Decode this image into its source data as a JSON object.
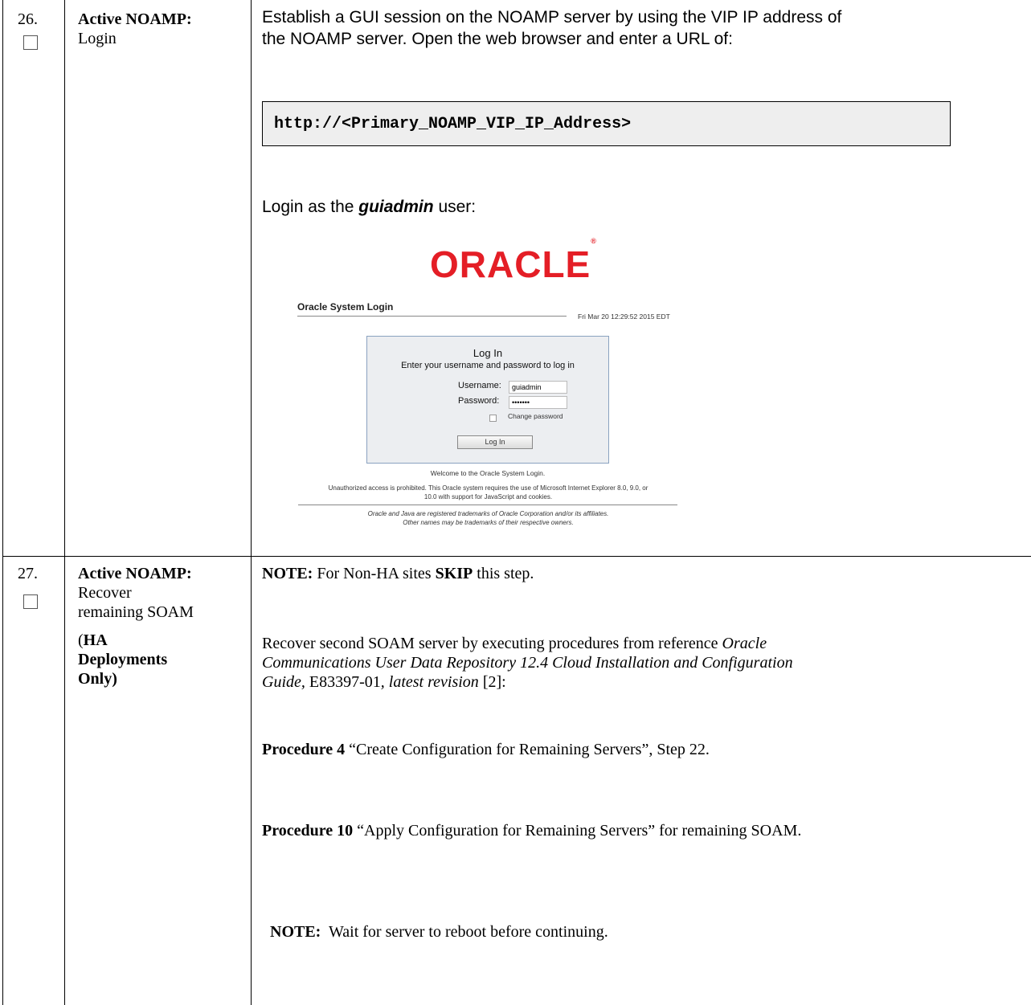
{
  "steps": [
    {
      "number": "26.",
      "actor": "Active NOAMP:",
      "title": "Login",
      "intro_line1": "Establish a GUI session on the NOAMP server by using the VIP IP address of",
      "intro_line2": "the NOAMP server. Open the web browser and enter a URL of:",
      "url": "http://<Primary_NOAMP_VIP_IP_Address>",
      "login_prefix": "Login as the ",
      "login_user": "guiadmin",
      "login_suffix": " user:",
      "screenshot": {
        "logo_text": "ORACLE",
        "logo_mark": "®",
        "heading": "Oracle System Login",
        "timestamp": "Fri Mar 20 12:29:52 2015 EDT",
        "box_title": "Log In",
        "box_subtitle": "Enter your username and password to log in",
        "username_label": "Username:",
        "username_value": "guiadmin",
        "password_label": "Password:",
        "password_value": "•••••••",
        "change_password_label": "Change password",
        "login_button": "Log In",
        "welcome": "Welcome to the Oracle System Login.",
        "notice_line1": "Unauthorized access is prohibited. This Oracle system requires the use of Microsoft Internet Explorer 8.0, 9.0, or",
        "notice_line2": "10.0 with support for JavaScript and cookies.",
        "trademark_line1": "Oracle and Java are registered trademarks of Oracle Corporation and/or its affiliates.",
        "trademark_line2": "Other names may be trademarks of their respective owners."
      }
    },
    {
      "number": "27.",
      "actor": "Active NOAMP:",
      "title_line1": "Recover",
      "title_line2": "remaining SOAM",
      "ha_open": "(",
      "ha_line1": "HA",
      "ha_line2": "Deployments",
      "ha_line3": "Only",
      "ha_close": ")",
      "note1_label": "NOTE:",
      "note1_a": " For Non-HA sites ",
      "note1_b": "SKIP",
      "note1_c": " this step.",
      "recover_line1_a": "Recover second SOAM server by executing procedures from reference ",
      "recover_line1_b": "Oracle",
      "recover_line2": "Communications User Data Repository 12.4 Cloud Installation and Configuration",
      "recover_line3_a": "Guide,",
      "recover_line3_b": " E83397-01",
      "recover_line3_c": ", latest revision",
      "recover_line3_d": " [2]:",
      "proc4_label": "Procedure 4",
      "proc4_text": " “Create Configuration for Remaining Servers”, Step 22.",
      "proc10_label": "Procedure 10",
      "proc10_text": " “Apply Configuration for Remaining Servers” for remaining SOAM.",
      "note2_label": "NOTE:",
      "note2_text": "  Wait for server to reboot before continuing."
    }
  ]
}
